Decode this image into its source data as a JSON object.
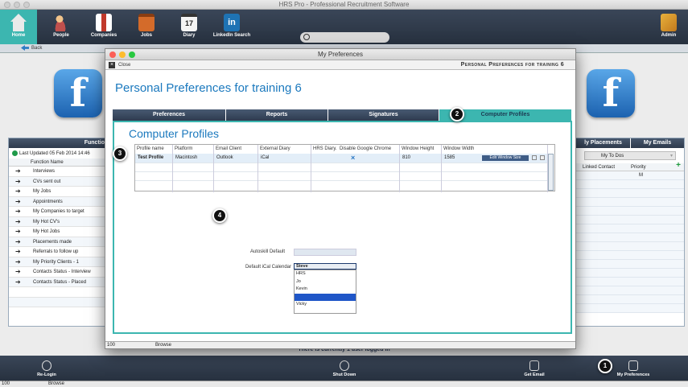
{
  "window": {
    "title": "HRS Pro - Professional Recruitment Software"
  },
  "toolbar": {
    "items": [
      {
        "label": "Home",
        "icon": "home-icon"
      },
      {
        "label": "People",
        "icon": "people-icon"
      },
      {
        "label": "Companies",
        "icon": "companies-icon"
      },
      {
        "label": "Jobs",
        "icon": "jobs-icon"
      },
      {
        "label": "Diary",
        "icon": "diary-icon"
      },
      {
        "label": "LinkedIn Search",
        "icon": "linkedin-icon"
      },
      {
        "label": "Admin",
        "icon": "admin-icon"
      }
    ],
    "diary_day": "17",
    "linkedin_glyph": "in"
  },
  "subbar": {
    "back_label": "Back"
  },
  "left_panel": {
    "header": "Functio",
    "updated": "Last Updated 05 Feb 2014 14:46",
    "column": "Function Name",
    "items": [
      "Interviews",
      "CVs sent out",
      "My Jobs",
      "Appointments",
      "My Companies to target",
      "My Hot CV's",
      "My Hot Jobs",
      "Placements made",
      "Referrals to follow up",
      "My Priority Clients - 1",
      "Contacts Status - Interview",
      "Contacts Status - Placed"
    ]
  },
  "right_panel": {
    "tabs": [
      "ly Placements",
      "My Emails"
    ],
    "select_value": "My To Dos",
    "col_linked": "Linked Contact",
    "col_priority": "Priority",
    "priority_value": "M"
  },
  "dialog": {
    "title": "My Preferences",
    "close_label": "Close",
    "crumb": "Personal Preferences for training 6",
    "heading": "Personal Preferences for training 6",
    "tabs": [
      "Preferences",
      "Reports",
      "Signatures",
      "Computer Profiles"
    ],
    "active_tab": "Computer Profiles",
    "section_heading": "Computer Profiles",
    "table": {
      "columns": [
        "Profile name",
        "Platform",
        "Email Client",
        "External Diary",
        "HRS Diary.",
        "Disable Google Chrome",
        "Window Height",
        "Window Width"
      ],
      "row": {
        "profile_name": "Test Profile",
        "platform": "Macintosh",
        "email_client": "Outlook",
        "external_diary": "iCal",
        "disable_chrome": "×",
        "window_height": "810",
        "window_width": "1585"
      },
      "edit_button": "Edit Window Size"
    },
    "autoskill_label": "Autoskill Default",
    "ical_label": "Default iCal Calendar",
    "ical_selected": "Steve",
    "ical_options": [
      "HRS",
      "Jo",
      "Kevin",
      "",
      "Vicky"
    ],
    "status": {
      "zoom": "100",
      "mode": "Browse"
    }
  },
  "bottom_bar": {
    "logged_in": "There is currently 1 user logged in",
    "items": [
      {
        "label": "Re-Login",
        "icon": "relogin-icon"
      },
      {
        "label": "Shut Down",
        "icon": "power-icon"
      },
      {
        "label": "Get Email",
        "icon": "email-icon"
      },
      {
        "label": "My Preferences",
        "icon": "preferences-icon"
      }
    ]
  },
  "status_strip": {
    "zoom": "100",
    "mode": "Browse"
  },
  "callouts": [
    "1",
    "2",
    "3",
    "4"
  ],
  "colors": {
    "accent": "#3cb6b0",
    "heading": "#1b79be",
    "toolbar": "#2e3a4c"
  }
}
